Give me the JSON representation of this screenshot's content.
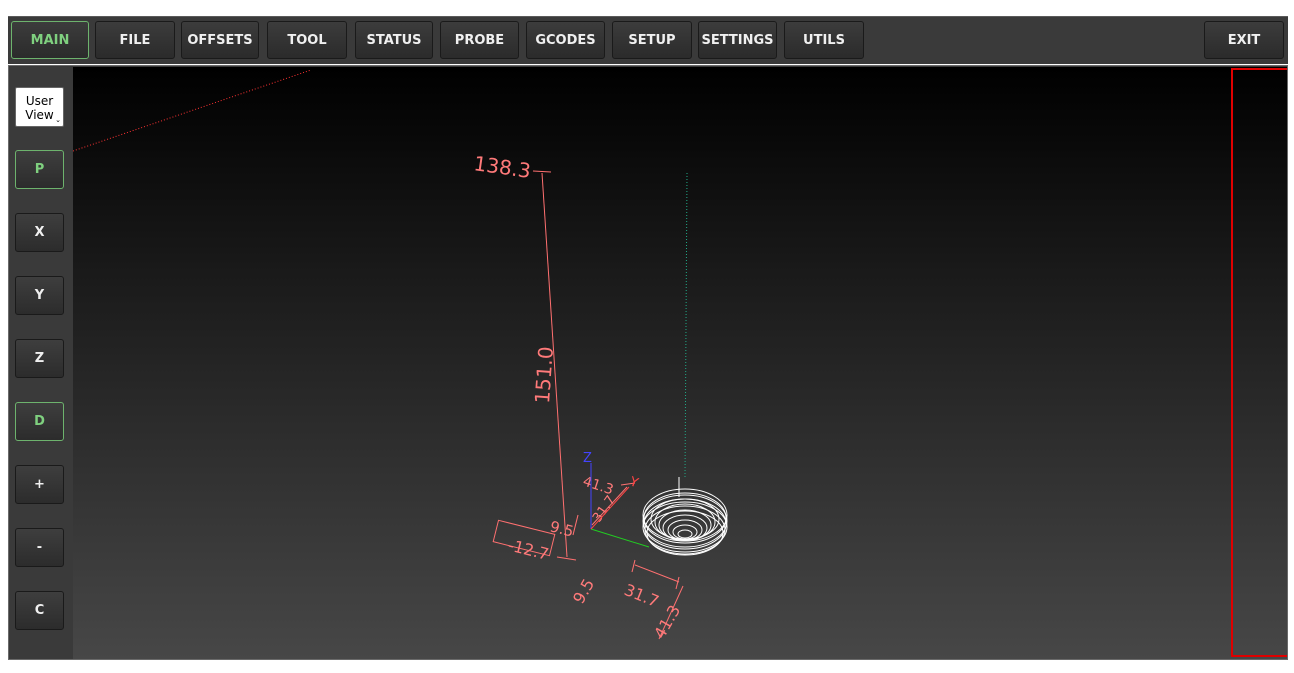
{
  "tabs": [
    {
      "label": "MAIN",
      "active": true
    },
    {
      "label": "FILE",
      "active": false
    },
    {
      "label": "OFFSETS",
      "active": false
    },
    {
      "label": "TOOL",
      "active": false
    },
    {
      "label": "STATUS",
      "active": false
    },
    {
      "label": "PROBE",
      "active": false
    },
    {
      "label": "GCODES",
      "active": false
    },
    {
      "label": "SETUP",
      "active": false
    },
    {
      "label": "SETTINGS",
      "active": false
    },
    {
      "label": "UTILS",
      "active": false
    }
  ],
  "exit_label": "EXIT",
  "view_select": {
    "line1": "User",
    "line2": "View"
  },
  "side_buttons": [
    {
      "label": "P",
      "active": true
    },
    {
      "label": "X",
      "active": false
    },
    {
      "label": "Y",
      "active": false
    },
    {
      "label": "Z",
      "active": false
    },
    {
      "label": "D",
      "active": true
    },
    {
      "label": "+",
      "active": false
    },
    {
      "label": "-",
      "active": false
    },
    {
      "label": "C",
      "active": false
    }
  ],
  "preview": {
    "dim_total_z": "138.3",
    "dim_height": "151.0",
    "dim_x_offset": "-12.7",
    "dim_small_a": "9.5",
    "dim_small_b": "9.5",
    "dim_y_len": "31.7",
    "dim_x_len": "41.3",
    "dim_inner_x": "41.3",
    "dim_inner_y": "31.7",
    "axis_z": "Z",
    "axis_y": "Y"
  },
  "colors": {
    "accent_active": "#7fd07f",
    "dimension": "#ff6060",
    "selection_box": "#e00000",
    "axis_x": "#ff4444",
    "axis_y": "#22cc22",
    "axis_z": "#4444ff"
  }
}
